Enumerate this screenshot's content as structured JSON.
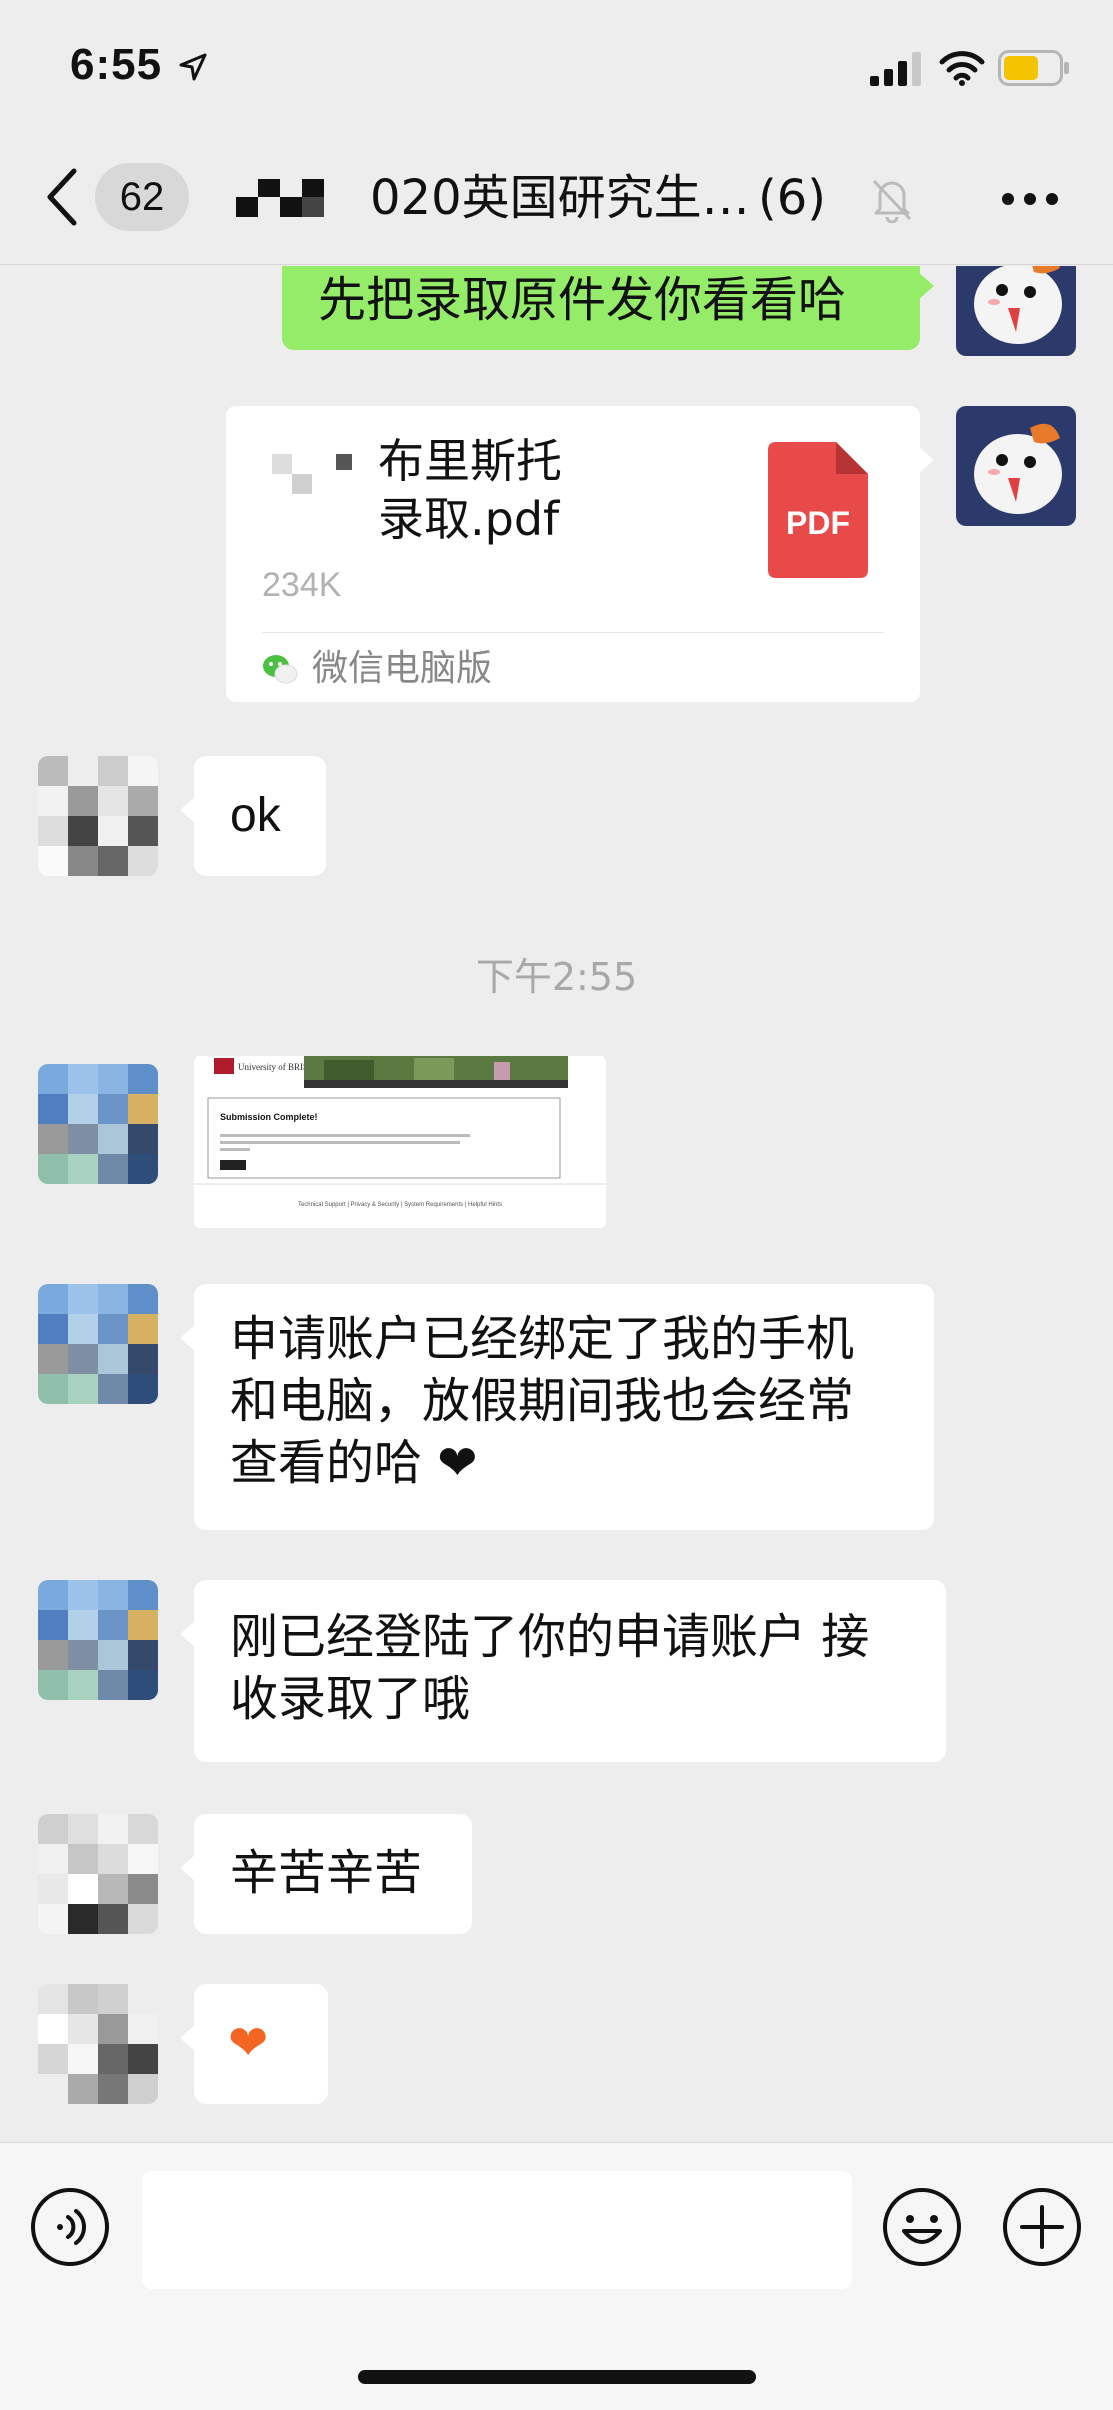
{
  "status_bar": {
    "time": "6:55",
    "icons": [
      "location-arrow-icon",
      "cellular-signal-icon",
      "wifi-icon",
      "battery-icon"
    ],
    "battery_color": "#f4c400"
  },
  "nav": {
    "back_icon": "chevron-left-icon",
    "unread_count": "62",
    "title": "020英国研究生…",
    "member_count": "(6)",
    "mute_icon": "bell-slash-icon",
    "more_icon": "ellipsis-icon"
  },
  "messages": [
    {
      "side": "right",
      "type": "text",
      "text": "先把录取原件发你看看哈"
    },
    {
      "side": "right",
      "type": "file",
      "file_name": "布里斯托\n录取.pdf",
      "file_size": "234K",
      "file_icon_label": "PDF",
      "source": "微信电脑版"
    },
    {
      "side": "left",
      "type": "text",
      "text": "ok"
    },
    {
      "type": "timestamp",
      "text": "下午2:55"
    },
    {
      "side": "left",
      "type": "image",
      "description": "University of Bristol screenshot"
    },
    {
      "side": "left",
      "type": "text",
      "text": "申请账户已经绑定了我的手机和电脑，放假期间我也会经常查看的哈 ❤"
    },
    {
      "side": "left",
      "type": "text",
      "text": "刚已经登陆了你的申请账户 接收录取了哦"
    },
    {
      "side": "left",
      "type": "text",
      "text": "辛苦辛苦"
    },
    {
      "side": "left",
      "type": "text",
      "text": "❤"
    }
  ],
  "thumbnail": {
    "logo_text": "University of BRISTOL",
    "heading": "Submission Complete!",
    "footer_links": "Technical Support | Privacy & Security | System Requirements | Helpful Hints"
  },
  "input_bar": {
    "placeholder": "",
    "icons": [
      "voice-icon",
      "emoji-icon",
      "plus-icon"
    ]
  },
  "colors": {
    "background": "#ededed",
    "sent_bubble": "#95ec69",
    "received_bubble": "#ffffff",
    "pdf_red": "#e84a4a",
    "heart": "#f26522"
  }
}
